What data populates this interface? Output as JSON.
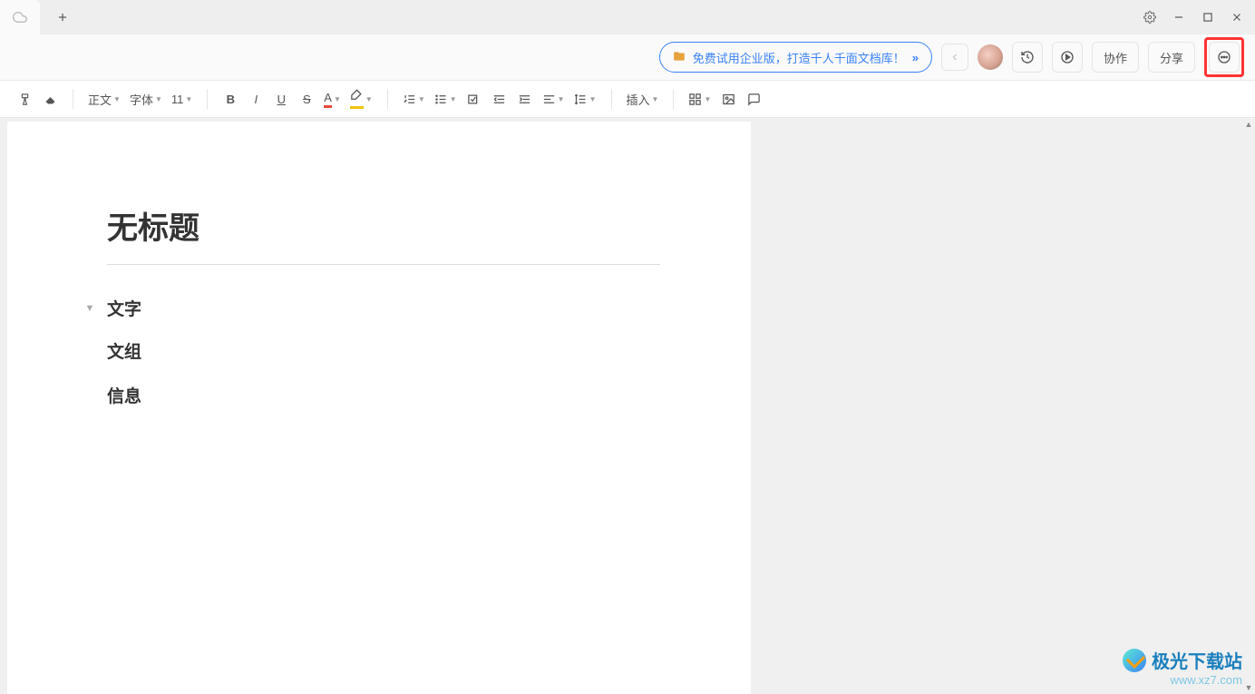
{
  "titlebar": {
    "active_tab_icon": "cloud-icon"
  },
  "header": {
    "promo_text": "免费试用企业版，打造千人千面文档库！",
    "collaborate_label": "协作",
    "share_label": "分享"
  },
  "toolbar": {
    "style_label": "正文",
    "font_label": "字体",
    "font_size": "11",
    "insert_label": "插入"
  },
  "document": {
    "title": "无标题",
    "blocks": [
      {
        "text": "文字",
        "collapsible": true
      },
      {
        "text": "文组",
        "collapsible": false
      },
      {
        "text": "信息",
        "collapsible": false
      }
    ]
  },
  "watermark": {
    "main": "极光下载站",
    "sub": "www.xz7.com"
  }
}
